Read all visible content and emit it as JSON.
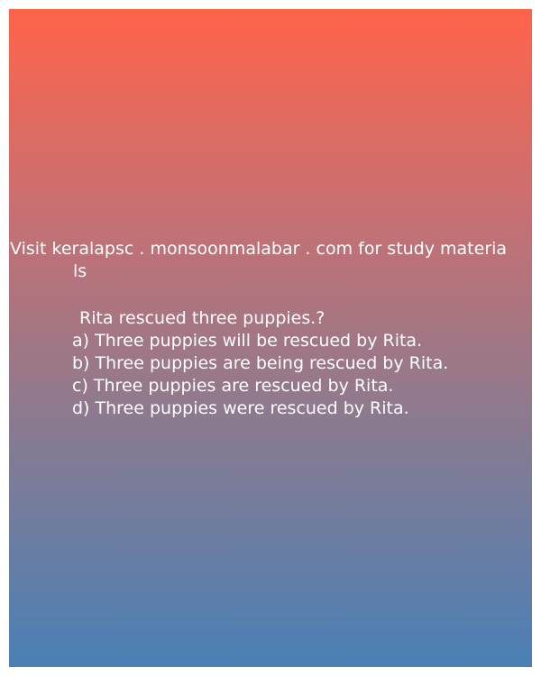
{
  "promo": {
    "line1": "Visit keralapsc . monsoonmalabar . com for study materia",
    "line2": "ls"
  },
  "question": "Rita rescued three puppies.?",
  "options": [
    "a) Three puppies will be rescued by Rita.",
    "b) Three puppies are being rescued by Rita.",
    "c) Three puppies are rescued by Rita.",
    "d) Three puppies were rescued by Rita."
  ],
  "colors": {
    "gradient_top": "#ff634a",
    "gradient_bottom": "#4a80b5",
    "text": "#ffffff"
  }
}
